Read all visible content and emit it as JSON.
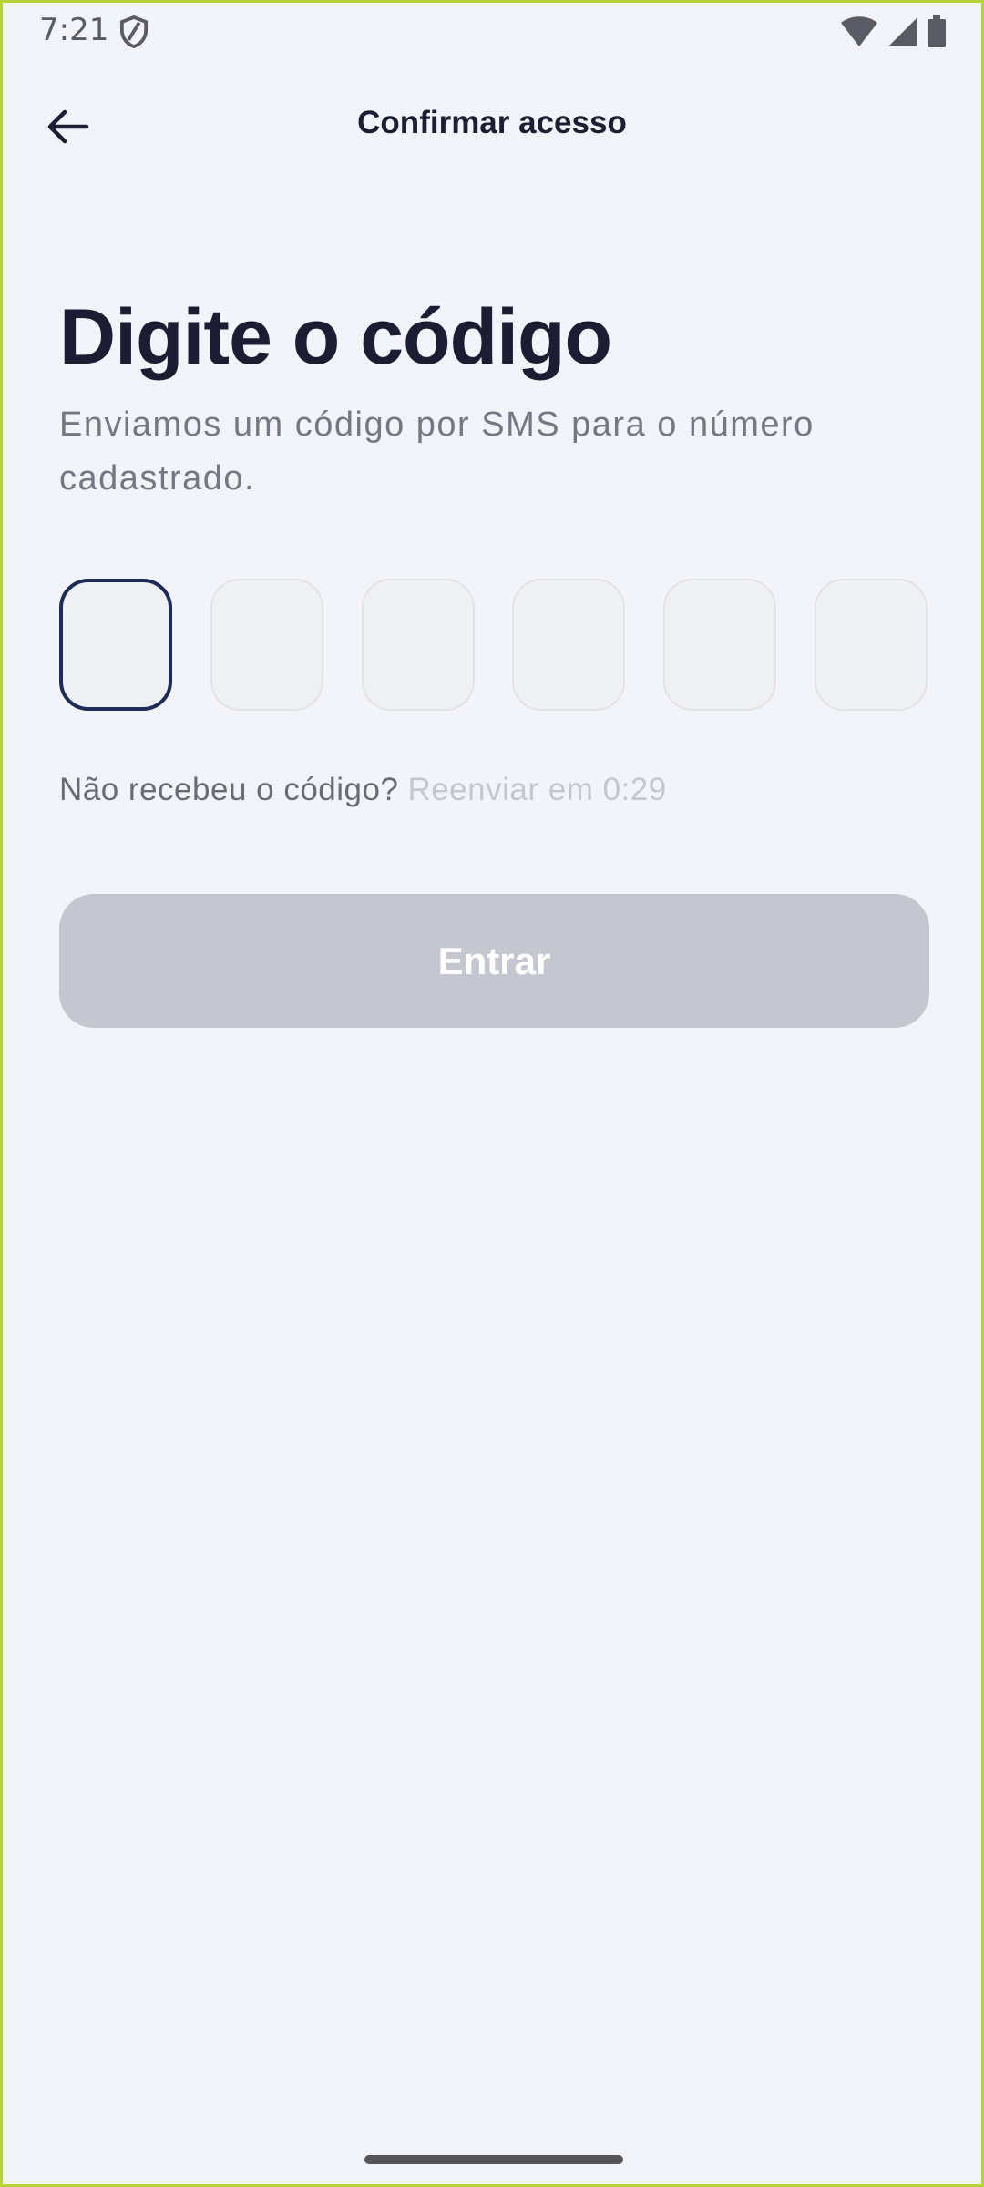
{
  "status_bar": {
    "time": "7:21",
    "icons": [
      "shield-icon",
      "wifi-icon",
      "cellular-signal-icon",
      "battery-icon"
    ]
  },
  "app_bar": {
    "back_icon": "arrow-left-icon",
    "title": "Confirmar acesso"
  },
  "main": {
    "title": "Digite o código",
    "subtitle": "Enviamos um código por SMS para o número cadastrado.",
    "code_length": 6,
    "active_box": 1,
    "resend_question": "Não recebeu o código?",
    "resend_timer": "Reenviar em 0:29",
    "submit_label": "Entrar"
  },
  "colors": {
    "background": "#f3f4f9",
    "title": "#1c1c33",
    "active_border": "#1e2b57",
    "button_disabled": "#c4c7cf",
    "frame": "#b5d334"
  }
}
